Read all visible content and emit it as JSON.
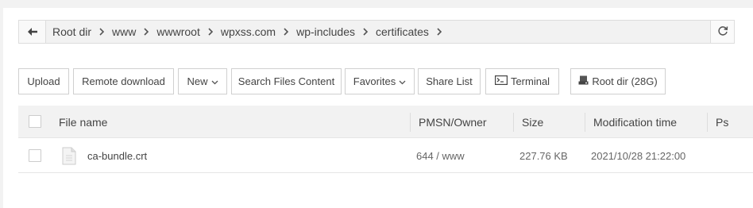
{
  "breadcrumb": {
    "items": [
      "Root dir",
      "www",
      "wwwroot",
      "wpxss.com",
      "wp-includes",
      "certificates"
    ]
  },
  "toolbar": {
    "upload": "Upload",
    "remote_download": "Remote download",
    "new": "New",
    "search_files_content": "Search Files Content",
    "favorites": "Favorites",
    "share_list": "Share List",
    "terminal": "Terminal",
    "root_dir_usage": "Root dir (28G)"
  },
  "table": {
    "headers": {
      "file_name": "File name",
      "permission_owner": "PMSN/Owner",
      "size": "Size",
      "modification_time": "Modification time",
      "ps": "Ps"
    },
    "rows": [
      {
        "name": "ca-bundle.crt",
        "permission_owner": "644 / www",
        "size": "227.76 KB",
        "modified": "2021/10/28 21:22:00",
        "ps": ""
      }
    ]
  },
  "icons": {
    "back": "arrow-left-icon",
    "refresh": "refresh-icon",
    "terminal": "terminal-icon",
    "disk": "disk-icon",
    "file": "file-icon"
  }
}
